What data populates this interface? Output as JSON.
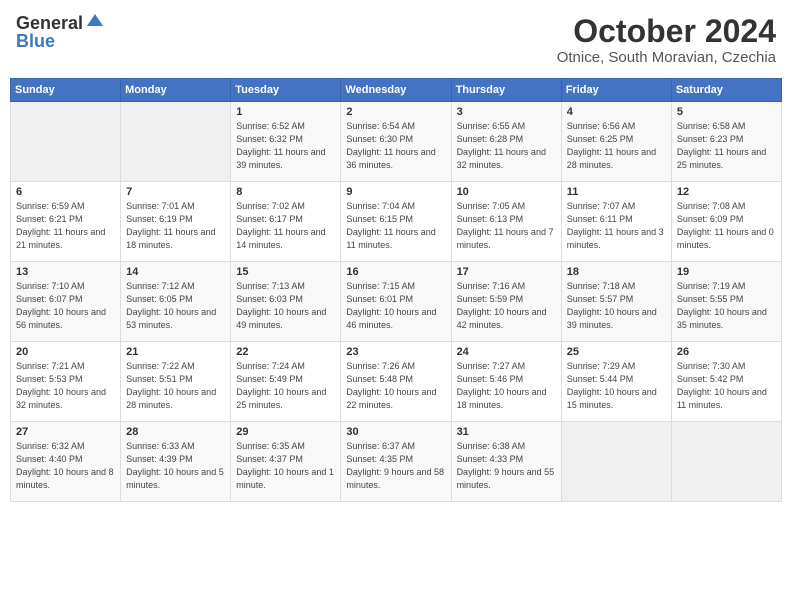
{
  "header": {
    "logo_general": "General",
    "logo_blue": "Blue",
    "month": "October 2024",
    "location": "Otnice, South Moravian, Czechia"
  },
  "days_of_week": [
    "Sunday",
    "Monday",
    "Tuesday",
    "Wednesday",
    "Thursday",
    "Friday",
    "Saturday"
  ],
  "weeks": [
    [
      {
        "day": "",
        "info": ""
      },
      {
        "day": "",
        "info": ""
      },
      {
        "day": "1",
        "info": "Sunrise: 6:52 AM\nSunset: 6:32 PM\nDaylight: 11 hours and 39 minutes."
      },
      {
        "day": "2",
        "info": "Sunrise: 6:54 AM\nSunset: 6:30 PM\nDaylight: 11 hours and 36 minutes."
      },
      {
        "day": "3",
        "info": "Sunrise: 6:55 AM\nSunset: 6:28 PM\nDaylight: 11 hours and 32 minutes."
      },
      {
        "day": "4",
        "info": "Sunrise: 6:56 AM\nSunset: 6:25 PM\nDaylight: 11 hours and 28 minutes."
      },
      {
        "day": "5",
        "info": "Sunrise: 6:58 AM\nSunset: 6:23 PM\nDaylight: 11 hours and 25 minutes."
      }
    ],
    [
      {
        "day": "6",
        "info": "Sunrise: 6:59 AM\nSunset: 6:21 PM\nDaylight: 11 hours and 21 minutes."
      },
      {
        "day": "7",
        "info": "Sunrise: 7:01 AM\nSunset: 6:19 PM\nDaylight: 11 hours and 18 minutes."
      },
      {
        "day": "8",
        "info": "Sunrise: 7:02 AM\nSunset: 6:17 PM\nDaylight: 11 hours and 14 minutes."
      },
      {
        "day": "9",
        "info": "Sunrise: 7:04 AM\nSunset: 6:15 PM\nDaylight: 11 hours and 11 minutes."
      },
      {
        "day": "10",
        "info": "Sunrise: 7:05 AM\nSunset: 6:13 PM\nDaylight: 11 hours and 7 minutes."
      },
      {
        "day": "11",
        "info": "Sunrise: 7:07 AM\nSunset: 6:11 PM\nDaylight: 11 hours and 3 minutes."
      },
      {
        "day": "12",
        "info": "Sunrise: 7:08 AM\nSunset: 6:09 PM\nDaylight: 11 hours and 0 minutes."
      }
    ],
    [
      {
        "day": "13",
        "info": "Sunrise: 7:10 AM\nSunset: 6:07 PM\nDaylight: 10 hours and 56 minutes."
      },
      {
        "day": "14",
        "info": "Sunrise: 7:12 AM\nSunset: 6:05 PM\nDaylight: 10 hours and 53 minutes."
      },
      {
        "day": "15",
        "info": "Sunrise: 7:13 AM\nSunset: 6:03 PM\nDaylight: 10 hours and 49 minutes."
      },
      {
        "day": "16",
        "info": "Sunrise: 7:15 AM\nSunset: 6:01 PM\nDaylight: 10 hours and 46 minutes."
      },
      {
        "day": "17",
        "info": "Sunrise: 7:16 AM\nSunset: 5:59 PM\nDaylight: 10 hours and 42 minutes."
      },
      {
        "day": "18",
        "info": "Sunrise: 7:18 AM\nSunset: 5:57 PM\nDaylight: 10 hours and 39 minutes."
      },
      {
        "day": "19",
        "info": "Sunrise: 7:19 AM\nSunset: 5:55 PM\nDaylight: 10 hours and 35 minutes."
      }
    ],
    [
      {
        "day": "20",
        "info": "Sunrise: 7:21 AM\nSunset: 5:53 PM\nDaylight: 10 hours and 32 minutes."
      },
      {
        "day": "21",
        "info": "Sunrise: 7:22 AM\nSunset: 5:51 PM\nDaylight: 10 hours and 28 minutes."
      },
      {
        "day": "22",
        "info": "Sunrise: 7:24 AM\nSunset: 5:49 PM\nDaylight: 10 hours and 25 minutes."
      },
      {
        "day": "23",
        "info": "Sunrise: 7:26 AM\nSunset: 5:48 PM\nDaylight: 10 hours and 22 minutes."
      },
      {
        "day": "24",
        "info": "Sunrise: 7:27 AM\nSunset: 5:46 PM\nDaylight: 10 hours and 18 minutes."
      },
      {
        "day": "25",
        "info": "Sunrise: 7:29 AM\nSunset: 5:44 PM\nDaylight: 10 hours and 15 minutes."
      },
      {
        "day": "26",
        "info": "Sunrise: 7:30 AM\nSunset: 5:42 PM\nDaylight: 10 hours and 11 minutes."
      }
    ],
    [
      {
        "day": "27",
        "info": "Sunrise: 6:32 AM\nSunset: 4:40 PM\nDaylight: 10 hours and 8 minutes."
      },
      {
        "day": "28",
        "info": "Sunrise: 6:33 AM\nSunset: 4:39 PM\nDaylight: 10 hours and 5 minutes."
      },
      {
        "day": "29",
        "info": "Sunrise: 6:35 AM\nSunset: 4:37 PM\nDaylight: 10 hours and 1 minute."
      },
      {
        "day": "30",
        "info": "Sunrise: 6:37 AM\nSunset: 4:35 PM\nDaylight: 9 hours and 58 minutes."
      },
      {
        "day": "31",
        "info": "Sunrise: 6:38 AM\nSunset: 4:33 PM\nDaylight: 9 hours and 55 minutes."
      },
      {
        "day": "",
        "info": ""
      },
      {
        "day": "",
        "info": ""
      }
    ]
  ]
}
